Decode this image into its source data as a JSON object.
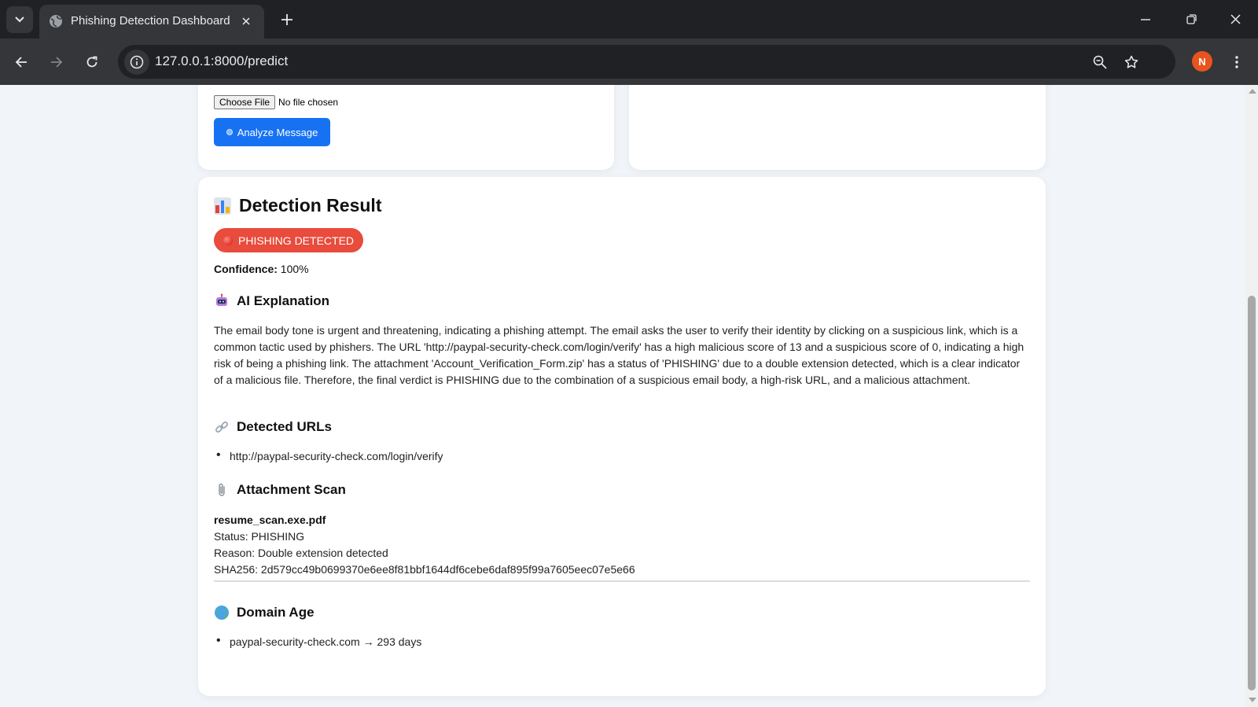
{
  "browser": {
    "tab_title": "Phishing Detection Dashboard",
    "url": "127.0.0.1:8000/predict",
    "profile_initial": "N"
  },
  "form": {
    "choose_file_label": "Choose File",
    "file_status": "No file chosen",
    "analyze_label": "Analyze Message"
  },
  "result": {
    "title": "Detection Result",
    "badge": "PHISHING DETECTED",
    "badge_color": "#e94b3c",
    "confidence_label": "Confidence:",
    "confidence_value": "100%",
    "ai_title": "AI Explanation",
    "ai_explanation": "The email body tone is urgent and threatening, indicating a phishing attempt. The email asks the user to verify their identity by clicking on a suspicious link, which is a common tactic used by phishers. The URL 'http://paypal-security-check.com/login/verify' has a high malicious score of 13 and a suspicious score of 0, indicating a high risk of being a phishing link. The attachment 'Account_Verification_Form.zip' has a status of 'PHISHING' due to a double extension detected, which is a clear indicator of a malicious file. Therefore, the final verdict is PHISHING due to the combination of a suspicious email body, a high-risk URL, and a malicious attachment.",
    "urls_title": "Detected URLs",
    "urls": [
      "http://paypal-security-check.com/login/verify"
    ],
    "attachment_title": "Attachment Scan",
    "attachment": {
      "name": "resume_scan.exe.pdf",
      "status": "Status: PHISHING",
      "reason": "Reason: Double extension detected",
      "sha256": "SHA256: 2d579cc49b0699370e6ee8f81bbf1644df6cebe6daf895f99a7605eec07e5e66"
    },
    "domain_title": "Domain Age",
    "domains": [
      "paypal-security-check.com → 293 days"
    ]
  },
  "accent_color": "#1672f3"
}
